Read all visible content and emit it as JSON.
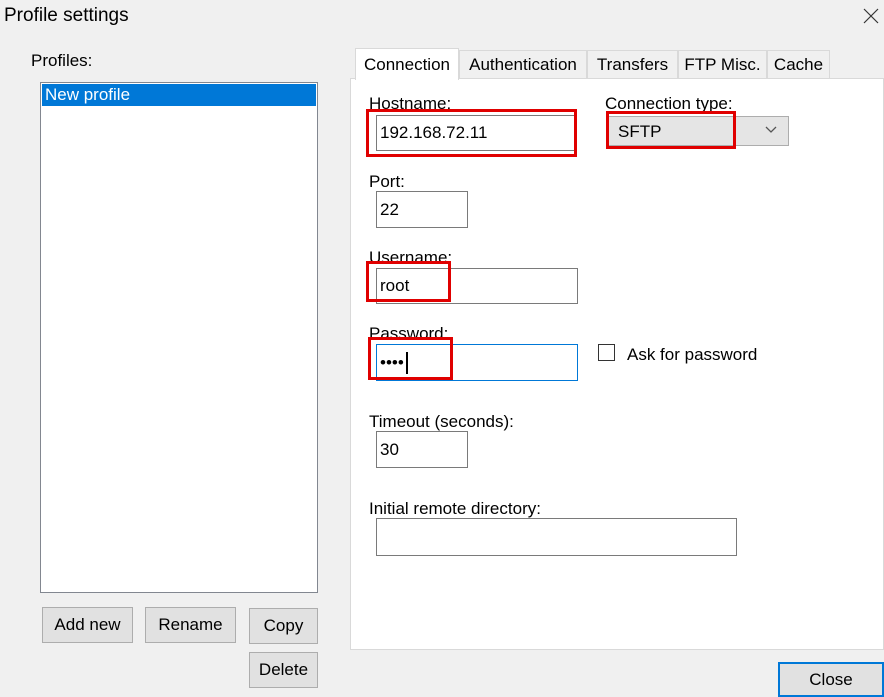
{
  "window": {
    "title": "Profile settings",
    "close_icon": "close-icon"
  },
  "profiles": {
    "label": "Profiles:",
    "items": [
      {
        "label": "New profile",
        "selected": true
      }
    ],
    "buttons": {
      "add_new": "Add new",
      "rename": "Rename",
      "copy": "Copy",
      "delete": "Delete"
    }
  },
  "tabs": [
    {
      "label": "Connection",
      "active": true
    },
    {
      "label": "Authentication",
      "active": false
    },
    {
      "label": "Transfers",
      "active": false
    },
    {
      "label": "FTP Misc.",
      "active": false
    },
    {
      "label": "Cache",
      "active": false
    }
  ],
  "connection": {
    "hostname_label": "Hostname:",
    "hostname_value": "192.168.72.11",
    "connection_type_label": "Connection type:",
    "connection_type_value": "SFTP",
    "port_label": "Port:",
    "port_value": "22",
    "username_label": "Username:",
    "username_value": "root",
    "password_label": "Password:",
    "password_value": "••••",
    "ask_password_label": "Ask for password",
    "ask_password_checked": false,
    "timeout_label": "Timeout (seconds):",
    "timeout_value": "30",
    "initial_dir_label": "Initial remote directory:",
    "initial_dir_value": ""
  },
  "footer": {
    "close_label": "Close"
  },
  "annotation_color": "#e00000",
  "accent_color": "#0078d7"
}
